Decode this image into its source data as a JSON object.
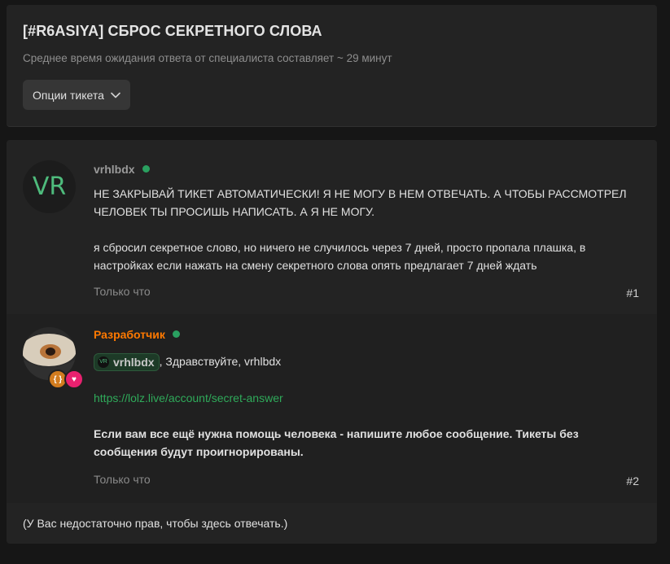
{
  "header": {
    "title": "[#R6ASIYA] СБРОС СЕКРЕТНОГО СЛОВА",
    "subtitle": "Среднее время ожидания ответа от специалиста составляет ~ 29 минут",
    "options_button": "Опции тикета"
  },
  "posts": [
    {
      "avatar_text": "VR",
      "username": "vrhlbdx",
      "paragraphs": [
        "НЕ ЗАКРЫВАЙ ТИКЕТ АВТОМАТИЧЕСКИ! Я НЕ МОГУ В НЕМ ОТВЕЧАТЬ. А ЧТОБЫ РАССМОТРЕЛ ЧЕЛОВЕК ТЫ ПРОСИШЬ НАПИСАТЬ. А Я НЕ МОГУ.",
        "я сбросил секретное слово, но ничего не случилось через 7 дней, просто пропала плашка, в настройках если нажать на смену секретного слова опять предлагает 7 дней ждать"
      ],
      "time": "Только что",
      "number": "#1"
    },
    {
      "username": "Разработчик",
      "mention": {
        "avatar_text": "VR",
        "name": "vrhlbdx"
      },
      "greeting": ", Здравствуйте, vrhlbdx",
      "link": "https://lolz.live/account/secret-answer",
      "bold_text": "Если вам все ещё нужна помощь человека - напишите любое сообщение. Тикеты без сообщения будут проигнорированы.",
      "time": "Только что",
      "number": "#2",
      "badges": {
        "code_icon": "{ }",
        "heart_icon": "♥"
      }
    }
  ],
  "footer_note": "(У Вас недостаточно прав, чтобы здесь отвечать.)",
  "colors": {
    "accent_green": "#2faa5a",
    "developer_orange": "#fe7900",
    "online": "#2aa060"
  }
}
